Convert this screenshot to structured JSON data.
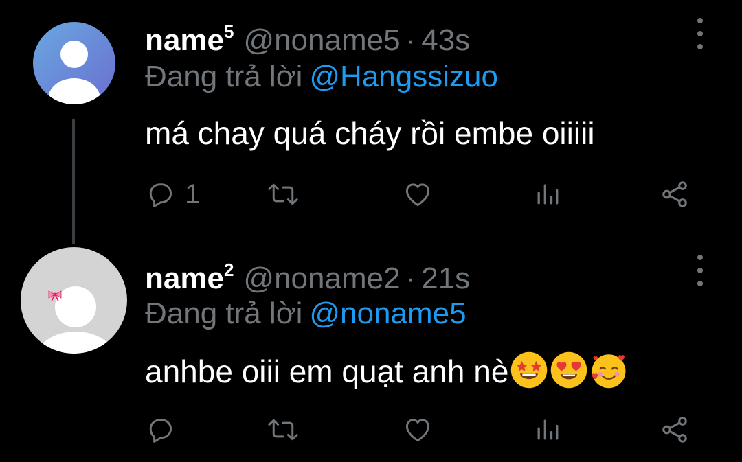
{
  "tweets": [
    {
      "display_name": "name",
      "name_superscript": "5",
      "handle": "@noname5",
      "separator": "·",
      "time": "43s",
      "reply_prefix": "Đang trả lời",
      "reply_mention": "@Hangssizuo",
      "text": "má chay quá cháy rồi embe oiiiii",
      "reply_count": "1",
      "avatar": "default-person-avatar-blue"
    },
    {
      "display_name": "name",
      "name_superscript": "2",
      "handle": "@noname2",
      "separator": "·",
      "time": "21s",
      "reply_prefix": "Đang trả lời",
      "reply_mention": "@noname5",
      "text": "anhbe oiii em quạt anh nè",
      "reply_count": "",
      "avatar": "default-person-avatar-gray-with-bow",
      "emojis": [
        "star-struck-emoji",
        "heart-eyes-emoji",
        "smiling-face-with-hearts-emoji"
      ]
    }
  ],
  "icons": {
    "reply": "reply-icon",
    "retweet": "retweet-icon",
    "like": "heart-icon",
    "views": "views-icon",
    "share": "share-icon",
    "more": "more-vertical-icon"
  },
  "colors": {
    "background": "#000000",
    "primary_text": "#ffffff",
    "secondary_text": "#71767b",
    "link": "#1d9bf0",
    "thread_line": "#3a3f44"
  }
}
